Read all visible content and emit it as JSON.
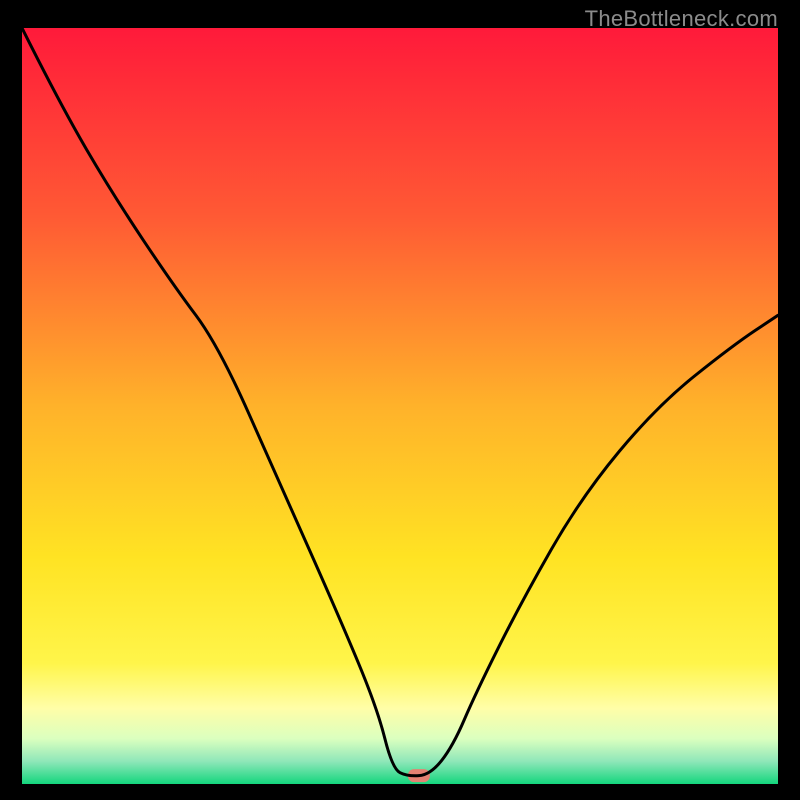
{
  "attribution": "TheBottleneck.com",
  "chart_data": {
    "type": "line",
    "title": "",
    "xlabel": "",
    "ylabel": "",
    "xlim": [
      0,
      100
    ],
    "ylim": [
      0,
      100
    ],
    "grid": false,
    "legend": false,
    "background_gradient": {
      "stops": [
        {
          "pos": 0,
          "color": "#ff1a3a"
        },
        {
          "pos": 0.25,
          "color": "#ff5a34"
        },
        {
          "pos": 0.5,
          "color": "#ffb22a"
        },
        {
          "pos": 0.7,
          "color": "#ffe323"
        },
        {
          "pos": 0.84,
          "color": "#fff54a"
        },
        {
          "pos": 0.9,
          "color": "#fffea8"
        },
        {
          "pos": 0.94,
          "color": "#dbffbf"
        },
        {
          "pos": 0.97,
          "color": "#8fe7b9"
        },
        {
          "pos": 1.0,
          "color": "#14d67d"
        }
      ]
    },
    "series": [
      {
        "name": "curve",
        "x": [
          0,
          5,
          12,
          20,
          26,
          34,
          42,
          47,
          49,
          51,
          54,
          57,
          60,
          66,
          74,
          84,
          94,
          100
        ],
        "y": [
          100,
          90,
          78,
          66,
          58,
          40,
          22,
          10,
          2,
          1,
          1.2,
          5,
          12,
          24,
          38,
          50,
          58,
          62
        ]
      }
    ],
    "marker": {
      "x": 52.5,
      "y": 1.1,
      "shape": "pill",
      "color": "#e48172"
    }
  }
}
